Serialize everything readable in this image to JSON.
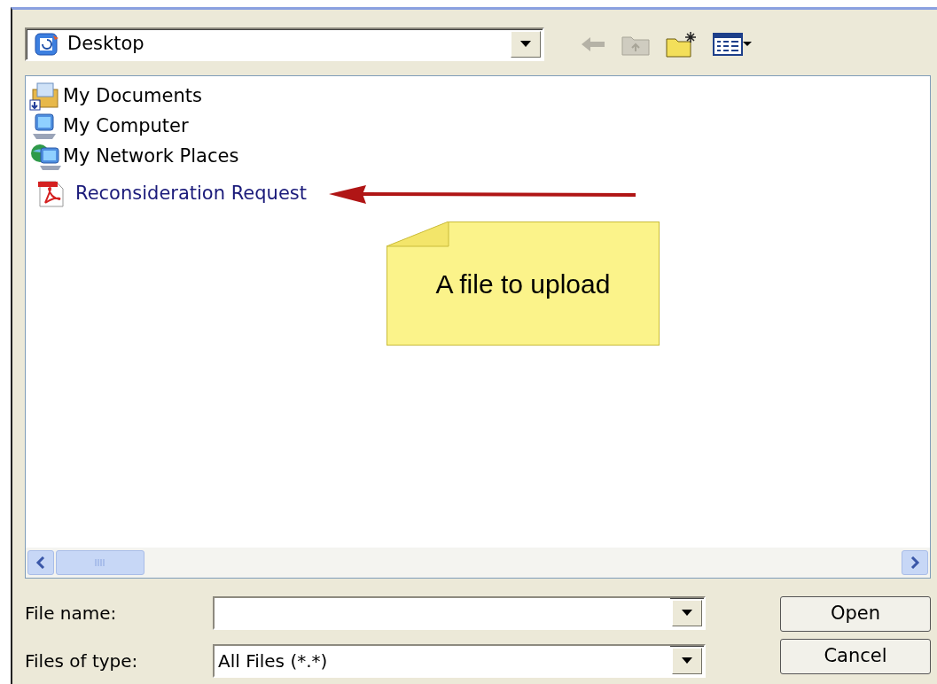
{
  "look_in": {
    "label": "Desktop"
  },
  "files": [
    {
      "name": "My Documents",
      "kind": "documents"
    },
    {
      "name": "My Computer",
      "kind": "computer"
    },
    {
      "name": "My Network Places",
      "kind": "network"
    },
    {
      "name": "Reconsideration Request",
      "kind": "pdf"
    }
  ],
  "callout": {
    "text": "A file to upload"
  },
  "file_name": {
    "label": "File name:"
  },
  "file_type": {
    "label": "Files of type:",
    "value": "All Files (*.*)"
  },
  "buttons": [
    "Open",
    "Cancel"
  ]
}
